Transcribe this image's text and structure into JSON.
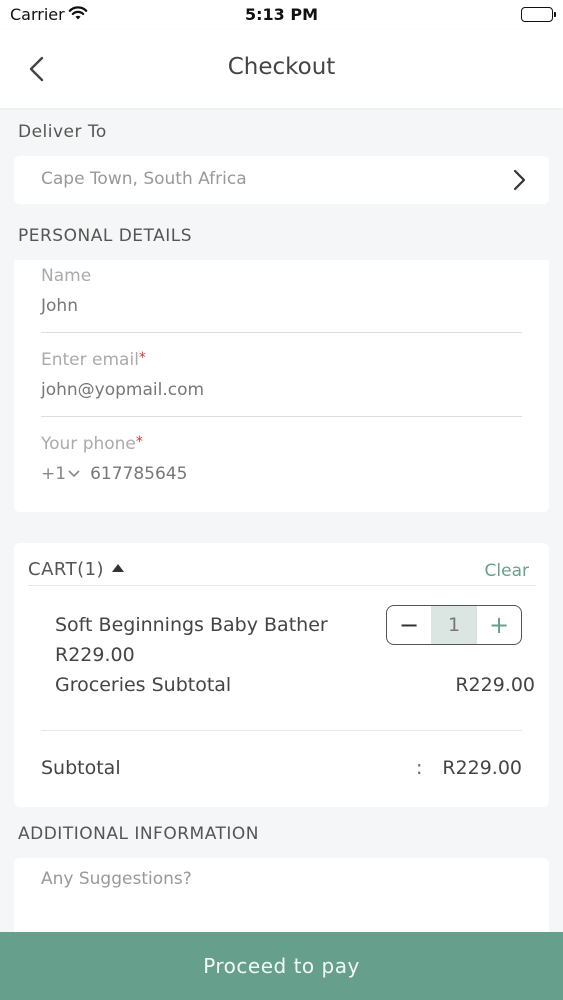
{
  "status_bar": {
    "carrier": "Carrier",
    "time": "5:13 PM"
  },
  "header": {
    "title": "Checkout"
  },
  "deliver": {
    "section_label": "Deliver To",
    "location": "Cape Town, South Africa"
  },
  "personal": {
    "section_label": "PERSONAL DETAILS",
    "name": {
      "label": "Name",
      "value": "John"
    },
    "email": {
      "label": "Enter email",
      "required_mark": "*",
      "value": "john@yopmail.com"
    },
    "phone": {
      "label": "Your phone",
      "required_mark": "*",
      "country_code": "+1",
      "value": "617785645"
    }
  },
  "cart": {
    "header": "CART(1)",
    "clear_label": "Clear",
    "item": {
      "name": "Soft Beginnings Baby Bather",
      "price": "R229.00",
      "quantity": "1",
      "minus_symbol": "−",
      "plus_symbol": "+"
    },
    "groceries_subtotal_label": "Groceries Subtotal",
    "groceries_subtotal_value": "R229.00",
    "subtotal_label": "Subtotal",
    "subtotal_separator": ":",
    "subtotal_value": "R229.00"
  },
  "additional": {
    "section_label": "ADDITIONAL INFORMATION",
    "placeholder": "Any Suggestions?"
  },
  "footer": {
    "pay_button": "Proceed to pay"
  },
  "colors": {
    "accent": "#679f8d",
    "background": "#f5f6f7",
    "required": "#d33333"
  }
}
